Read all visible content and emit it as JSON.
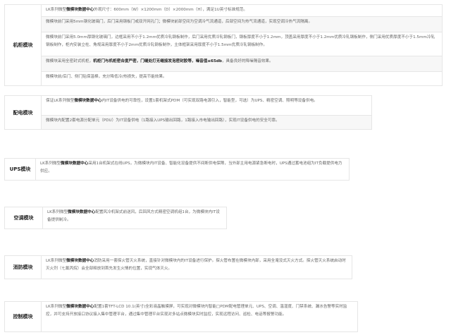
{
  "sections": [
    {
      "title": "机柜模块",
      "rows": [
        {
          "pre": "LK系列微型",
          "strong": "微模块数据中心",
          "post": "外观尺寸：600mm（W）×1200mm（D）×2000mm（H），满足1U英寸标准规范。"
        },
        {
          "pre": "",
          "strong": "",
          "post": "微模块前门采用5mm钢化玻璃门，后门采用钢板门或双开网孔门；微模块前部空间为空调冷气流通道，后部空间为热气流通道，实现空调冷热气流隔离。"
        },
        {
          "pre": "",
          "strong": "",
          "post": "微模块前门采用5.0mm厚钢化玻璃门，边框采用不小于1.2mm优质冷轧钢板制作，后门采用优质冷轧钢板门，钢板厚度不小于1.2mm，顶盖采用厚度不小于1.2mm优质冷轧钢板制作，侧门采用优质厚度不小于1.5mm冷轧钢板制作，柜内安装立柱、角规采用厚度不小于2mm优质冷轧钢板制作，主体框架采用厚度不小于1.5mm优质冷轧钢板制作。"
        },
        {
          "pre": "微模块采用全密封式机柜，",
          "strong": "机柜门与机柜密合度严密，门缝处打无缝接发泡密封胶等，噪音值≤65db",
          "post": "，具备良好的降噪隔音效果。"
        },
        {
          "pre": "",
          "strong": "",
          "post": "微模块前/后门、侧门贴保温棉，充分降低冷/热损失，提高节能效果。"
        }
      ]
    },
    {
      "title": "配电模块",
      "rows": [
        {
          "pre": "保证LK系列微型",
          "strong": "微模块数据中心",
          "post": "内IT设备供电的可靠性，设置1套机架式PDM（可实现双路电源引入，智能型，可选）为UPS、精密空调、照明等设备供电。"
        },
        {
          "pre": "",
          "strong": "",
          "post": "微模块内配置2套电源分配单元（PDU）为IT设备供电（1路接入UPS输出回路，1路接入市电输出回路），实现IT设备供电的安全可靠。"
        }
      ]
    },
    {
      "title": "UPS模块",
      "rows": [
        {
          "pre": "LK系列微型",
          "strong": "微模块数据中心",
          "post": "采用1台机架式在线UPS，为微模块内IT设备、智能化设备提供不间断供电保障，当外部主用电源紧急断电时，UPS通过蓄电池组为IT负载提供电力供应。"
        }
      ]
    },
    {
      "title": "空调模块",
      "rows": [
        {
          "pre": "LK系列微型",
          "strong": "微模块数据中心",
          "post": "配置风冷机架式前送风，后回风方式精密空调机组1台，为微模块内IT设备提供制冷。"
        }
      ]
    },
    {
      "title": "消防模块",
      "rows": [
        {
          "pre": "LK系列微型",
          "strong": "微模块数据中心",
          "post": "消防采用一套探火管灭火系统，直接针对微模块内的IT设备进行保护。探火管布置在微模块内部，采用全淹没式灭火方式。探火管灭火系统启动时灭火剂（七氟丙烷）会全部释放到首先发生火情的位置，实现气体灭火。"
        }
      ]
    },
    {
      "title": "控制模块",
      "rows": [
        {
          "pre": "LK系列微型",
          "strong": "微模块数据中心",
          "post": "配置1套TFT-LCD 10.1(英寸)全彩液晶触摸屏，可实现对微模块内智能□PDM配电管理单元、UPS、空调、温湿度、门禁系统、漏水告警等实时监控，并可支持开放接口协议接入集中管理平台，通过集中管理平台实现对多站点微模块实时监控，实现远程访问、巡检、电话等报警功能。"
        }
      ]
    }
  ]
}
